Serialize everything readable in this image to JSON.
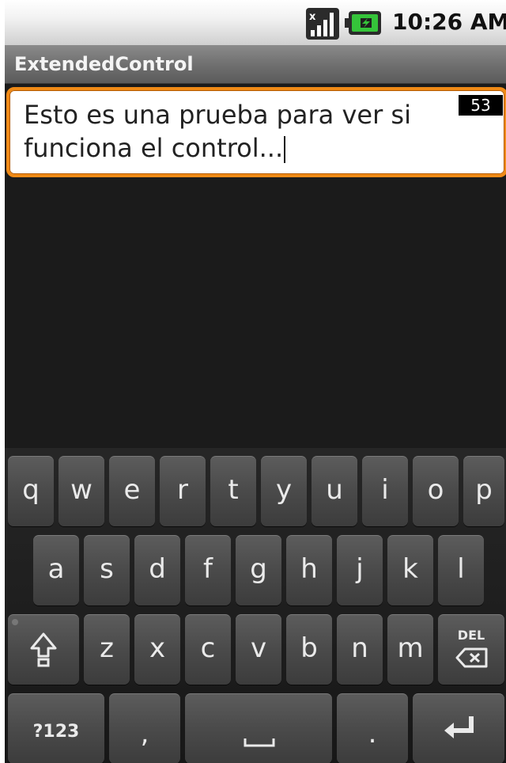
{
  "status_bar": {
    "time": "10:26 AM",
    "icons": [
      "signal-no-data-icon",
      "battery-charging-icon"
    ]
  },
  "title_bar": {
    "title": "ExtendedControl"
  },
  "text_field": {
    "value_line1": "Esto es una prueba para ver si",
    "value_line2": "funciona el control...",
    "char_count": "53",
    "accent_color": "#f08a16"
  },
  "keyboard": {
    "row1": [
      "q",
      "w",
      "e",
      "r",
      "t",
      "y",
      "u",
      "i",
      "o",
      "p"
    ],
    "row2": [
      "a",
      "s",
      "d",
      "f",
      "g",
      "h",
      "j",
      "k",
      "l"
    ],
    "row3": [
      "z",
      "x",
      "c",
      "v",
      "b",
      "n",
      "m"
    ],
    "delete_label": "DEL",
    "symbols_label": "?123",
    "comma_label": ",",
    "period_label": ".",
    "icons": [
      "shift-icon",
      "delete-icon",
      "space-icon",
      "enter-icon"
    ]
  }
}
